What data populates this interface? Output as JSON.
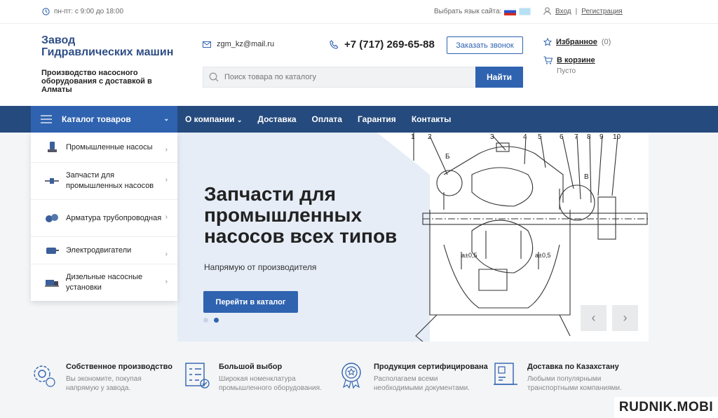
{
  "topbar": {
    "hours": "пн-пт: с 9:00 до 18:00",
    "lang_label": "Выбрать язык сайта:",
    "login": "Вход",
    "separator": "|",
    "register": "Регистрация"
  },
  "header": {
    "logo_title_1": "Завод",
    "logo_title_2": "Гидравлических машин",
    "logo_sub": "Производство насосного оборудования с доставкой в Алматы",
    "email": "zgm_kz@mail.ru",
    "phone": "+7 (717) 269-65-88",
    "call_button": "Заказать звонок",
    "search_placeholder": "Поиск товара по каталогу",
    "search_button": "Найти",
    "favorites": "Избранное",
    "favorites_count": "(0)",
    "cart": "В корзине",
    "cart_status": "Пусто"
  },
  "nav": {
    "catalog": "Каталог товаров",
    "items": [
      "О компании",
      "Доставка",
      "Оплата",
      "Гарантия",
      "Контакты"
    ]
  },
  "sidebar": {
    "items": [
      {
        "label": "Промышленные насосы",
        "icon": "pump-icon"
      },
      {
        "label": "Запчасти для промышленных насосов",
        "icon": "spare-parts-icon"
      },
      {
        "label": "Арматура трубопроводная",
        "icon": "valve-icon"
      },
      {
        "label": "Электродвигатели",
        "icon": "motor-icon"
      },
      {
        "label": "Дизельные насосные установки",
        "icon": "diesel-unit-icon"
      }
    ]
  },
  "hero": {
    "title": "Запчасти для промышленных насосов всех типов",
    "subtitle": "Напрямую от производителя",
    "button": "Перейти в каталог",
    "slides": 2,
    "active_slide": 2,
    "drawing_labels": [
      "1",
      "2",
      "3",
      "4",
      "5",
      "6",
      "7",
      "8",
      "9",
      "10",
      "Б",
      "В",
      "а±0,5",
      "а±0,5"
    ]
  },
  "features": [
    {
      "title": "Собственное производство",
      "text": "Вы экономите, покупая напрямую у завода.",
      "icon": "gear-icon"
    },
    {
      "title": "Большой выбор",
      "text": "Широкая номенклатура промышленного оборудования.",
      "icon": "checklist-icon"
    },
    {
      "title": "Продукция сертифицирована",
      "text": "Располагаем всеми необходимыми документами.",
      "icon": "certificate-icon"
    },
    {
      "title": "Доставка по Казахстану",
      "text": "Любыми популярными транспортными компаниями.",
      "icon": "delivery-doc-icon"
    }
  ],
  "watermark": "RUDNIK.MOBI",
  "colors": {
    "primary": "#2f63b0",
    "nav": "#254a7d",
    "logo": "#2f4f86"
  }
}
